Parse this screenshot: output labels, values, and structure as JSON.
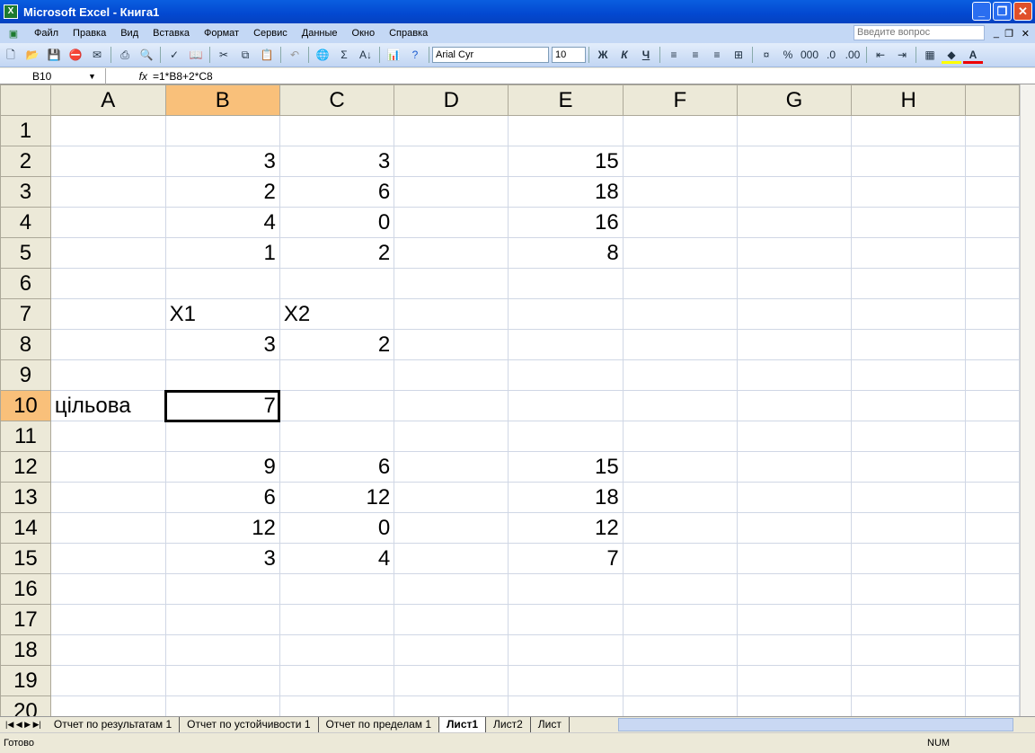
{
  "title": "Microsoft Excel - Книга1",
  "menu": [
    "Файл",
    "Правка",
    "Вид",
    "Вставка",
    "Формат",
    "Сервис",
    "Данные",
    "Окно",
    "Справка"
  ],
  "ask_placeholder": "Введите вопрос",
  "toolbar": {
    "font": "Arial Cyr",
    "size": "10",
    "bold": "Ж",
    "italic": "К",
    "underline": "Ч",
    "percent": "%",
    "thousands": "000"
  },
  "formula": {
    "cell": "B10",
    "fx": "fx",
    "value": "=1*B8+2*C8"
  },
  "columns": [
    "A",
    "B",
    "C",
    "D",
    "E",
    "F",
    "G",
    "H",
    ""
  ],
  "rows": [
    [
      "",
      "",
      "",
      "",
      "",
      "",
      "",
      ""
    ],
    [
      "",
      "3",
      "3",
      "",
      "15",
      "",
      "",
      ""
    ],
    [
      "",
      "2",
      "6",
      "",
      "18",
      "",
      "",
      ""
    ],
    [
      "",
      "4",
      "0",
      "",
      "16",
      "",
      "",
      ""
    ],
    [
      "",
      "1",
      "2",
      "",
      "8",
      "",
      "",
      ""
    ],
    [
      "",
      "",
      "",
      "",
      "",
      "",
      "",
      ""
    ],
    [
      "",
      "X1",
      "X2",
      "",
      "",
      "",
      "",
      ""
    ],
    [
      "",
      "3",
      "2",
      "",
      "",
      "",
      "",
      ""
    ],
    [
      "",
      "",
      "",
      "",
      "",
      "",
      "",
      ""
    ],
    [
      "цільова",
      "7",
      "",
      "",
      "",
      "",
      "",
      ""
    ],
    [
      "",
      "",
      "",
      "",
      "",
      "",
      "",
      ""
    ],
    [
      "",
      "9",
      "6",
      "",
      "15",
      "",
      "",
      ""
    ],
    [
      "",
      "6",
      "12",
      "",
      "18",
      "",
      "",
      ""
    ],
    [
      "",
      "12",
      "0",
      "",
      "12",
      "",
      "",
      ""
    ],
    [
      "",
      "3",
      "4",
      "",
      "7",
      "",
      "",
      ""
    ],
    [
      "",
      "",
      "",
      "",
      "",
      "",
      "",
      ""
    ],
    [
      "",
      "",
      "",
      "",
      "",
      "",
      "",
      ""
    ],
    [
      "",
      "",
      "",
      "",
      "",
      "",
      "",
      ""
    ],
    [
      "",
      "",
      "",
      "",
      "",
      "",
      "",
      ""
    ],
    [
      "",
      "",
      "",
      "",
      "",
      "",
      "",
      ""
    ]
  ],
  "sheets": [
    "Отчет по результатам 1",
    "Отчет по устойчивости 1",
    "Отчет по пределам 1",
    "Лист1",
    "Лист2",
    "Лист"
  ],
  "active_sheet": "Лист1",
  "status": "Готово",
  "num_indicator": "NUM"
}
